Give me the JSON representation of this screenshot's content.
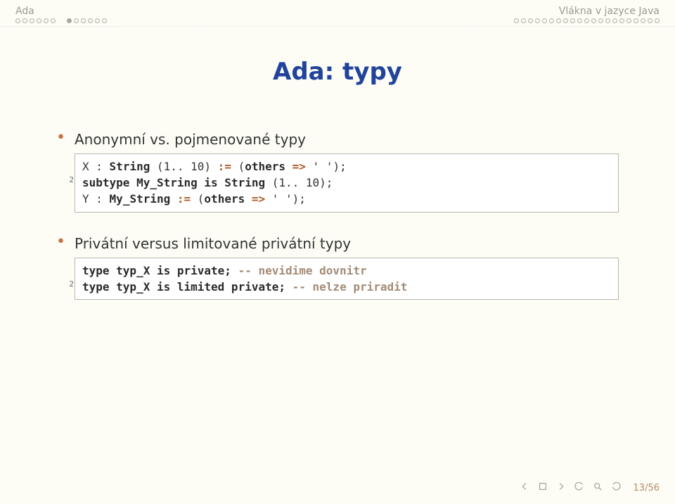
{
  "header": {
    "left": "Ada",
    "right": "Vlákna v jazyce Java"
  },
  "title": "Ada: typy",
  "bullets": {
    "b1": "Anonymní vs. pojmenované typy",
    "b2": "Privátní versus limitované privátní typy"
  },
  "code1": {
    "l1": {
      "var": "X",
      "colon": " : ",
      "type": "String",
      "open": " (1.. 10) ",
      "assign": ":=",
      "openp": " (",
      "kw_others": "others",
      "arrow": " => ",
      "val": "' '",
      "close": ");"
    },
    "l2": {
      "kw": "subtype",
      "name": " My_String ",
      "is": "is",
      "type": " String",
      "rng": " (1.. 10);"
    },
    "l3": {
      "var": "Y",
      "colon": " : ",
      "type": "My_String",
      "sp": " ",
      "assign": ":=",
      "openp": " (",
      "kw_others": "others",
      "arrow": " => ",
      "val": "' '",
      "close": ");"
    },
    "lineno2": "2"
  },
  "code2": {
    "l1": {
      "kw": "type",
      "name": " typ_X ",
      "is": "is",
      "priv": " private;",
      "cmt": " -- nevidime dovnitr"
    },
    "l2": {
      "kw": "type",
      "name": " typ_X ",
      "is": "is",
      "lim": " limited private;",
      "cmt": " -- nelze priradit"
    },
    "lineno2": "2"
  },
  "footer": {
    "page": "13/56"
  }
}
